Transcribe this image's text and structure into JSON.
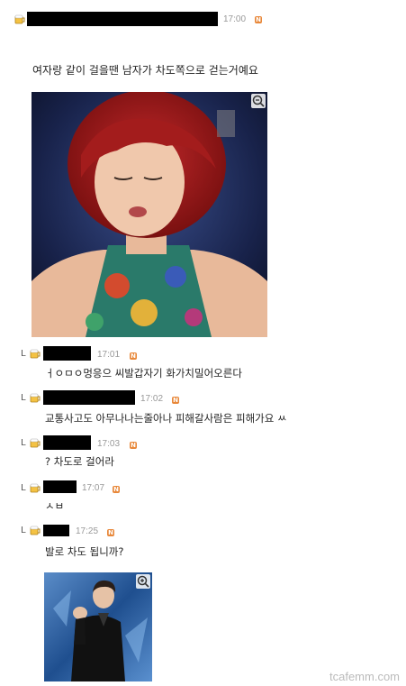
{
  "post": {
    "time": "17:00",
    "badge": "N",
    "body": "여자랑 같이 걸을땐 남자가 차도쪽으로 걷는거예요"
  },
  "comments": [
    {
      "time": "17:01",
      "badge": "N",
      "text": "ㅓㅇㅁㅇ멍응으 씨발갑자기 화가치밀어오른다"
    },
    {
      "time": "17:02",
      "badge": "N",
      "text": "교통사고도 아무나나는줄아나 피해갈사람은 피해가요 ㅆ"
    },
    {
      "time": "17:03",
      "badge": "N",
      "text": "? 차도로 걸어라"
    },
    {
      "time": "17:07",
      "badge": "N",
      "text": "ㅅㅂ"
    },
    {
      "time": "17:25",
      "badge": "N",
      "text": "발로 차도 됩니까?"
    }
  ],
  "reply_arrow": "L",
  "watermark": "tcafemm.com",
  "icons": {
    "zoom": "zoom-icon",
    "avatar": "beer-mug-avatar-icon"
  },
  "colors": {
    "badge": "#e8883a",
    "redaction": "#000000"
  }
}
